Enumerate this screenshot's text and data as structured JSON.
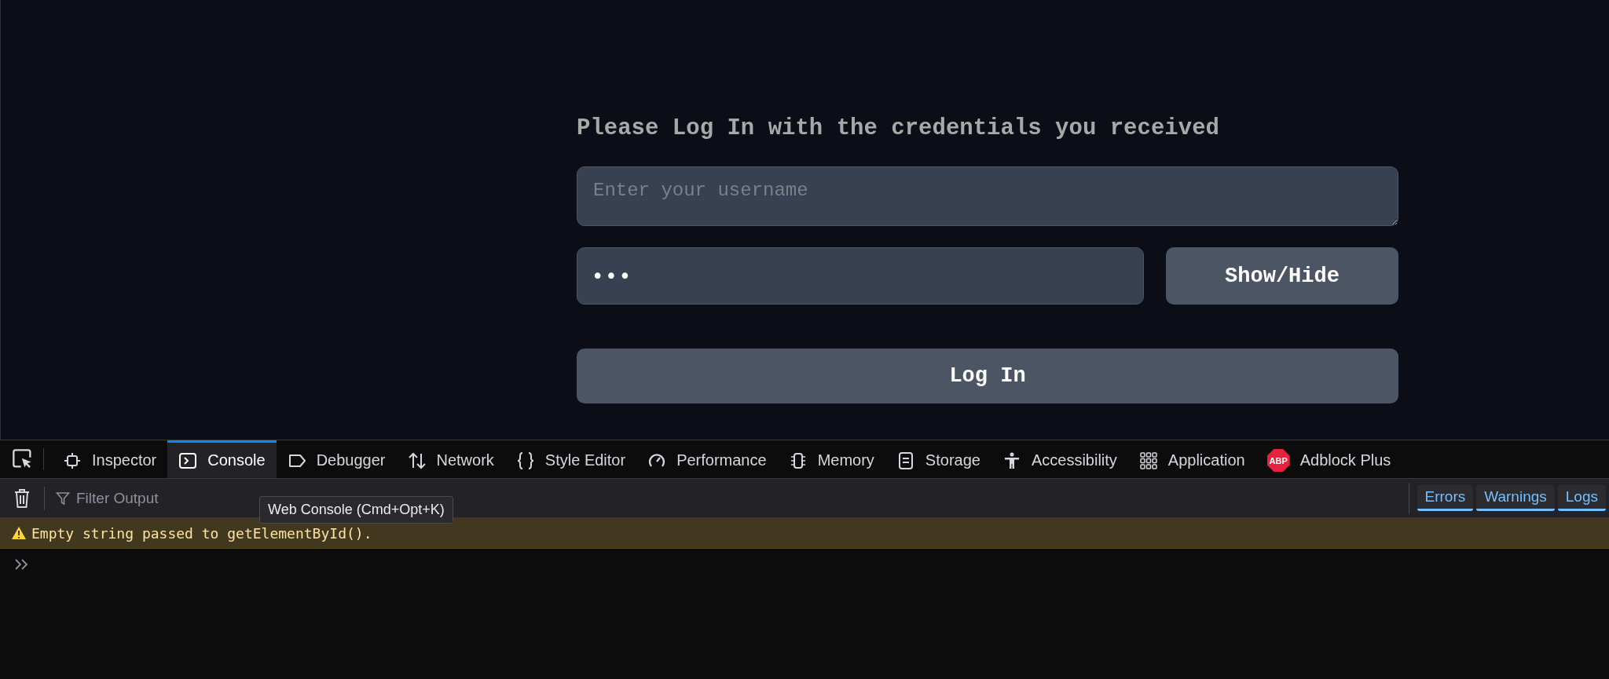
{
  "page": {
    "heading": "Please Log In with the credentials you received",
    "username": {
      "placeholder": "Enter your username"
    },
    "password": {
      "value": "•••"
    },
    "show_hide_button": "Show/Hide",
    "login_button": "Log In"
  },
  "devtools": {
    "tabs": [
      {
        "label": "Inspector",
        "selected": false
      },
      {
        "label": "Console",
        "selected": true
      },
      {
        "label": "Debugger",
        "selected": false
      },
      {
        "label": "Network",
        "selected": false
      },
      {
        "label": "Style Editor",
        "selected": false
      },
      {
        "label": "Performance",
        "selected": false
      },
      {
        "label": "Memory",
        "selected": false
      },
      {
        "label": "Storage",
        "selected": false
      },
      {
        "label": "Accessibility",
        "selected": false
      },
      {
        "label": "Application",
        "selected": false
      },
      {
        "label": "Adblock Plus",
        "selected": false,
        "badge": "ABP"
      }
    ],
    "filter": {
      "placeholder": "Filter Output"
    },
    "tooltip": "Web Console (Cmd+Opt+K)",
    "filter_buttons": [
      {
        "label": "Errors",
        "on": true
      },
      {
        "label": "Warnings",
        "on": true
      },
      {
        "label": "Logs",
        "on": true
      }
    ],
    "messages": [
      {
        "kind": "warning",
        "text": "Empty string passed to getElementById()."
      }
    ]
  }
}
